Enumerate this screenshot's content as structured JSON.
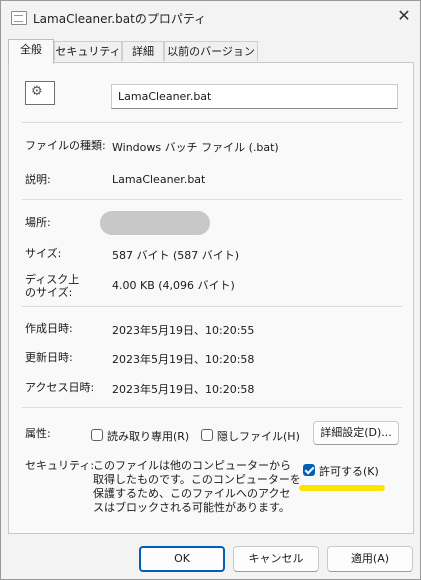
{
  "window": {
    "title": "LamaCleaner.batのプロパティ",
    "close_glyph": "✕"
  },
  "tabs": [
    {
      "label": "全般",
      "active": true
    },
    {
      "label": "セキュリティ",
      "active": false
    },
    {
      "label": "詳細",
      "active": false
    },
    {
      "label": "以前のバージョン",
      "active": false
    }
  ],
  "general": {
    "icon_glyph": "⚙",
    "file_name": "LamaCleaner.bat",
    "rows": {
      "type": {
        "label": "ファイルの種類:",
        "value": "Windows バッチ ファイル (.bat)"
      },
      "description": {
        "label": "説明:",
        "value": "LamaCleaner.bat"
      },
      "location": {
        "label": "場所:",
        "value": ""
      },
      "size": {
        "label": "サイズ:",
        "value": "587 バイト (587 バイト)"
      },
      "size_on_disk": {
        "label_line1": "ディスク上",
        "label_line2": "のサイズ:",
        "value": "4.00 KB (4,096 バイト)"
      },
      "created": {
        "label": "作成日時:",
        "value": "2023年5月19日、10:20:55"
      },
      "modified": {
        "label": "更新日時:",
        "value": "2023年5月19日、10:20:58"
      },
      "accessed": {
        "label": "アクセス日時:",
        "value": "2023年5月19日、10:20:58"
      }
    },
    "attributes": {
      "label": "属性:",
      "read_only": {
        "label": "読み取り専用(R)",
        "checked": false
      },
      "hidden": {
        "label": "隠しファイル(H)",
        "checked": false
      },
      "advanced_button": "詳細設定(D)..."
    },
    "security": {
      "label": "セキュリティ:",
      "text": "このファイルは他のコンピューターから取得したものです。このコンピューターを保護するため、このファイルへのアクセスはブロックされる可能性があります。",
      "unblock": {
        "label": "許可する(K)",
        "checked": true
      }
    }
  },
  "buttons": {
    "ok": "OK",
    "cancel": "キャンセル",
    "apply": "適用(A)"
  },
  "colors": {
    "accent": "#005fb8",
    "highlight": "#ffe400",
    "redaction": "#c8c8c8"
  }
}
